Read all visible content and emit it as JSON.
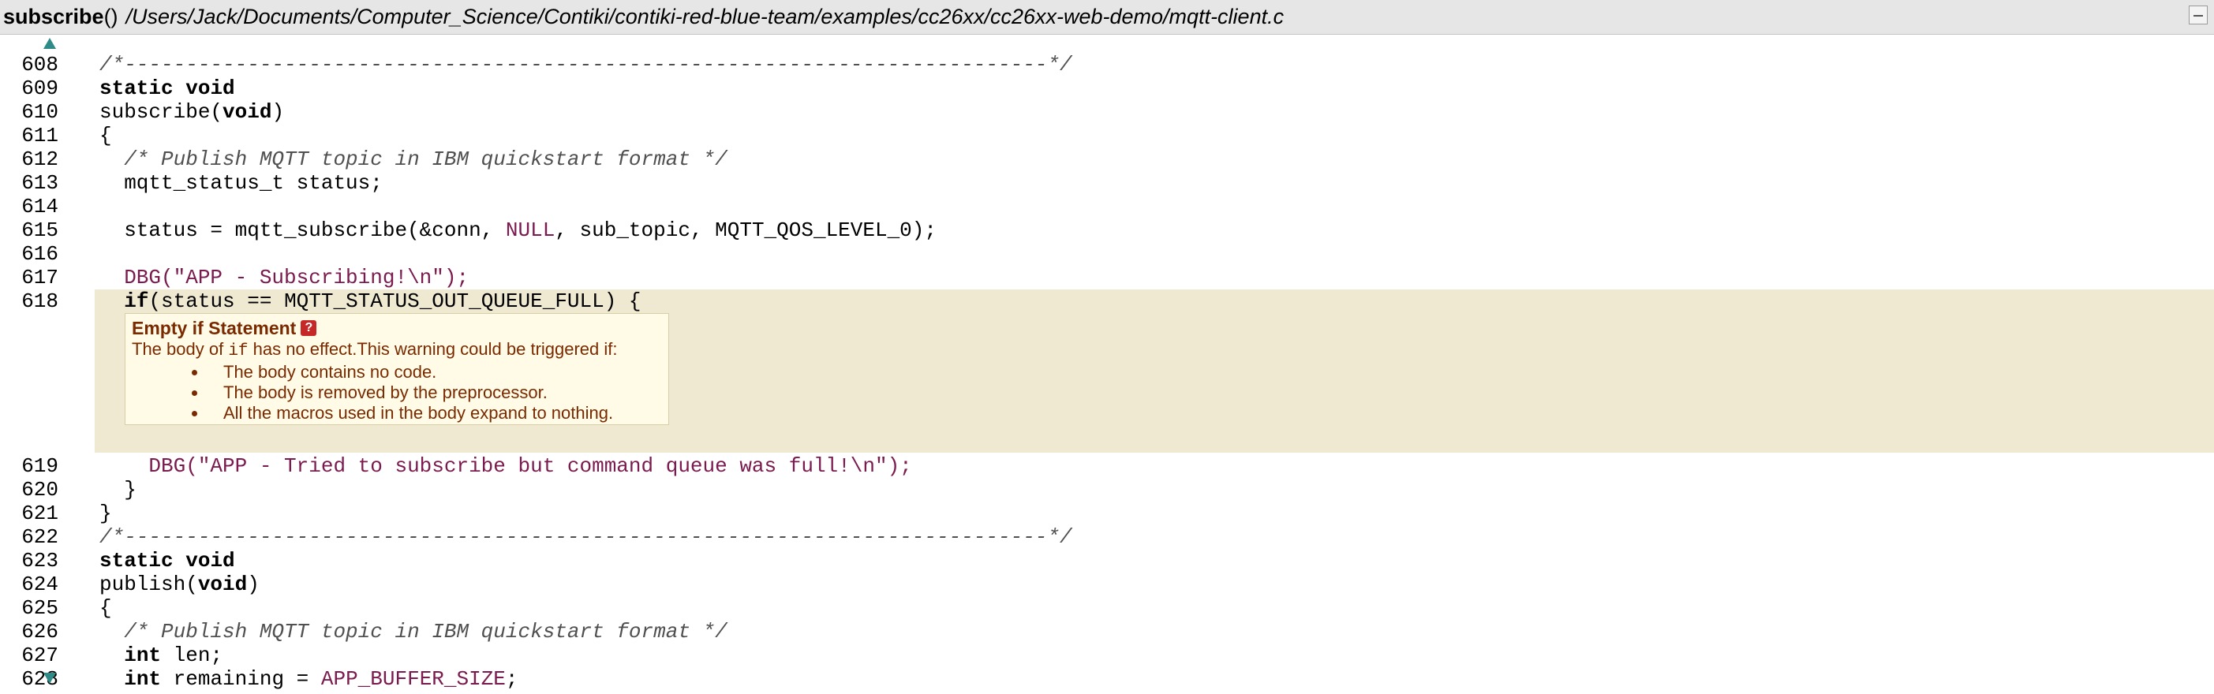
{
  "header": {
    "function_name": "subscribe",
    "parens": "()",
    "file_path": "/Users/Jack/Documents/Computer_Science/Contiki/contiki-red-blue-team/examples/cc26xx/cc26xx-web-demo/mqtt-client.c"
  },
  "code": {
    "lines": [
      {
        "no": "608",
        "segments": [
          {
            "t": "/*---------------------------------------------------------------------------*/",
            "c": "cm"
          }
        ]
      },
      {
        "no": "609",
        "segments": [
          {
            "t": "static",
            "c": "kw"
          },
          {
            "t": " ",
            "c": ""
          },
          {
            "t": "void",
            "c": "kw"
          }
        ]
      },
      {
        "no": "610",
        "segments": [
          {
            "t": "subscribe(",
            "c": ""
          },
          {
            "t": "void",
            "c": "kw"
          },
          {
            "t": ")",
            "c": ""
          }
        ]
      },
      {
        "no": "611",
        "segments": [
          {
            "t": "{",
            "c": ""
          }
        ]
      },
      {
        "no": "612",
        "segments": [
          {
            "t": "  /* Publish MQTT topic in IBM quickstart format */",
            "c": "cm"
          }
        ]
      },
      {
        "no": "613",
        "segments": [
          {
            "t": "  mqtt_status_t status;",
            "c": ""
          }
        ]
      },
      {
        "no": "614",
        "segments": []
      },
      {
        "no": "615",
        "segments": [
          {
            "t": "  status = mqtt_subscribe(&conn, ",
            "c": ""
          },
          {
            "t": "NULL",
            "c": "mc"
          },
          {
            "t": ", sub_topic, MQTT_QOS_LEVEL_0);",
            "c": ""
          }
        ]
      },
      {
        "no": "616",
        "segments": []
      },
      {
        "no": "617",
        "segments": [
          {
            "t": "  DBG(\"APP - Subscribing!\\n\");",
            "c": "st"
          }
        ]
      },
      {
        "no": "618",
        "hl": true,
        "segments": [
          {
            "t": "  ",
            "c": ""
          },
          {
            "t": "if",
            "c": "kw"
          },
          {
            "t": "(status == MQTT_STATUS_OUT_QUEUE_FULL) {",
            "c": ""
          }
        ]
      }
    ],
    "lines_after": [
      {
        "no": "619",
        "segments": [
          {
            "t": "    DBG(\"APP - Tried to subscribe but command queue was full!\\n\");",
            "c": "st"
          }
        ]
      },
      {
        "no": "620",
        "segments": [
          {
            "t": "  }",
            "c": ""
          }
        ]
      },
      {
        "no": "621",
        "segments": [
          {
            "t": "}",
            "c": ""
          }
        ]
      },
      {
        "no": "622",
        "segments": [
          {
            "t": "/*---------------------------------------------------------------------------*/",
            "c": "cm"
          }
        ]
      },
      {
        "no": "623",
        "segments": [
          {
            "t": "static",
            "c": "kw"
          },
          {
            "t": " ",
            "c": ""
          },
          {
            "t": "void",
            "c": "kw"
          }
        ]
      },
      {
        "no": "624",
        "segments": [
          {
            "t": "publish(",
            "c": ""
          },
          {
            "t": "void",
            "c": "kw"
          },
          {
            "t": ")",
            "c": ""
          }
        ]
      },
      {
        "no": "625",
        "segments": [
          {
            "t": "{",
            "c": ""
          }
        ]
      },
      {
        "no": "626",
        "segments": [
          {
            "t": "  /* Publish MQTT topic in IBM quickstart format */",
            "c": "cm"
          }
        ]
      },
      {
        "no": "627",
        "segments": [
          {
            "t": "  ",
            "c": ""
          },
          {
            "t": "int",
            "c": "kw"
          },
          {
            "t": " len;",
            "c": ""
          }
        ]
      },
      {
        "no": "628",
        "segments": [
          {
            "t": "  ",
            "c": ""
          },
          {
            "t": "int",
            "c": "kw"
          },
          {
            "t": " remaining = ",
            "c": ""
          },
          {
            "t": "APP_BUFFER_SIZE",
            "c": "mc"
          },
          {
            "t": ";",
            "c": ""
          }
        ]
      }
    ]
  },
  "warning": {
    "title": "Empty if Statement",
    "help_icon": "?",
    "desc_before": "The body of ",
    "desc_code": "if",
    "desc_after": " has no effect.This warning could be triggered if:",
    "items": [
      "The body contains no code.",
      "The body is removed by the preprocessor.",
      "All the macros used in the body expand to nothing."
    ]
  },
  "colors": {
    "highlight_band": "#efe9d2",
    "warning_bg": "#fffbe6",
    "warning_text": "#7a2a00",
    "string_macro": "#7a1a4e",
    "nav_arrow": "#2e8b87"
  }
}
